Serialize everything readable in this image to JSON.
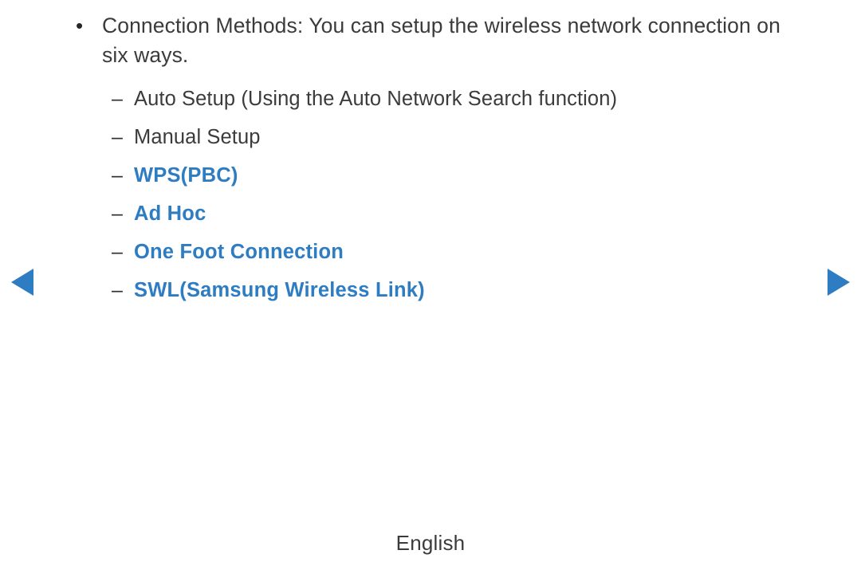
{
  "colors": {
    "background": "#ffffff",
    "text": "#3b3b3b",
    "highlight": "#2e7cc2",
    "marker": "#2f2f2f"
  },
  "content": {
    "main_item": {
      "bullet": "•",
      "text": "Connection Methods: You can setup the wireless network connection on six ways."
    },
    "sub_items": [
      {
        "dash": "–",
        "label": "Auto Setup (Using the Auto Network Search function)",
        "highlighted": false
      },
      {
        "dash": "–",
        "label": "Manual Setup",
        "highlighted": false
      },
      {
        "dash": "–",
        "label": "WPS(PBC)",
        "highlighted": true
      },
      {
        "dash": "–",
        "label": "Ad Hoc",
        "highlighted": true
      },
      {
        "dash": "–",
        "label": "One Foot Connection",
        "highlighted": true
      },
      {
        "dash": "–",
        "label": "SWL(Samsung Wireless Link)",
        "highlighted": true
      }
    ]
  },
  "navigation": {
    "previous_icon": "triangle-left-icon",
    "next_icon": "triangle-right-icon"
  },
  "footer": {
    "language": "English"
  }
}
